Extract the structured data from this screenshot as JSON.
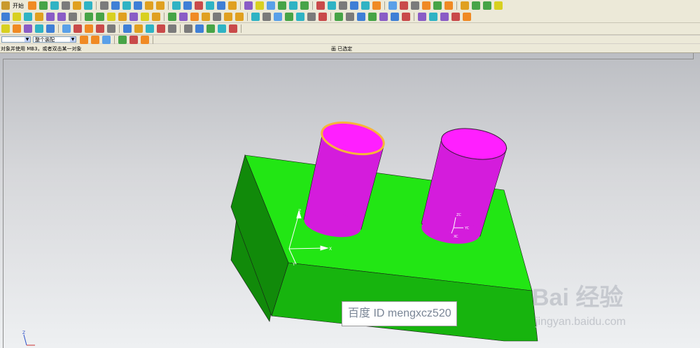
{
  "menu": {
    "start_label": "开始"
  },
  "toolbar": {
    "row1_icons": [
      "new-icon",
      "open-icon",
      "save-icon",
      "cut-icon",
      "copy-icon",
      "paste-icon",
      "undo-icon",
      "redo-icon",
      "select-icon",
      "zoom-fit-icon",
      "rotate-icon",
      "pan-icon",
      "cube-icon",
      "sphere-icon",
      "sketch-icon",
      "layer-icon",
      "measure-icon",
      "point-icon",
      "plane-icon",
      "edge-icon",
      "face-icon",
      "body-icon",
      "snap-icon",
      "analysis-icon",
      "render-icon",
      "shade-icon",
      "wire-icon",
      "view-icon",
      "camera-icon",
      "lights-icon",
      "grid-icon",
      "color-icon",
      "filter-icon",
      "info-icon",
      "group-icon",
      "assembly-icon",
      "drafting-icon",
      "motion-icon",
      "cam-icon",
      "help-icon"
    ],
    "row2_icons": [
      "block-icon",
      "cylinder-icon",
      "cone-icon",
      "extrude-icon",
      "revolve-icon",
      "hole-icon",
      "boss-icon",
      "pocket-icon",
      "pad-icon",
      "slot-icon",
      "groove-icon",
      "thread-icon",
      "blend-icon",
      "chamfer-icon",
      "shell-icon",
      "trim-icon",
      "split-icon",
      "unite-icon",
      "subtract-icon",
      "intersect-icon",
      "mirror-icon",
      "pattern-icon",
      "offset-icon",
      "scale-icon",
      "draft-icon",
      "sweep-icon",
      "loft-icon",
      "surface-icon",
      "sew-icon",
      "patch-icon",
      "curve-icon",
      "line-icon",
      "arc-icon",
      "spline-icon",
      "fillet-icon",
      "move-icon",
      "copy-feature-icon",
      "suppress-icon",
      "edit-icon",
      "replay-icon"
    ],
    "row3_icons": [
      "sketch-line-icon",
      "sketch-arc-icon",
      "sketch-fillet-icon",
      "sketch-trim-icon",
      "sketch-extend-icon",
      "dimension-icon",
      "constraint-icon",
      "surface-mesh-icon",
      "through-curves-icon",
      "swept-icon",
      "ruled-icon",
      "bounded-plane-icon",
      "offset-surface-icon",
      "extension-icon",
      "trim-sheet-icon",
      "thicken-icon",
      "section-icon",
      "studio-icon",
      "flange-icon",
      "sheet-metal-icon"
    ],
    "row4_icons": [
      "select-filter-icon",
      "point-snap-icon",
      "endpoint-icon",
      "midpoint-icon",
      "center-icon",
      "quadrant-icon"
    ]
  },
  "filter_bar": {
    "type_filter_value": "",
    "assembly_filter_value": "整个装配"
  },
  "status_bar": {
    "prompt": "对象并使用 MB3，或者双击某一对象",
    "selection": "画 已选定"
  },
  "overlay": {
    "watermark_text": "百度 ID mengxcz520",
    "baidu_logo": "Bai 经验",
    "baidu_url": "jingyan.baidu.com"
  },
  "axes": {
    "part_x": "X",
    "part_y": "Y",
    "part_z": "Z",
    "wcs_xc": "XC",
    "wcs_yc": "YC",
    "wcs_zc": "ZC"
  },
  "colors": {
    "block_top": "#22e614",
    "block_front": "#17b40e",
    "block_side": "#118a0a",
    "cylinder_body": "#d41cdc",
    "cylinder_top": "#ff1fff",
    "highlight_edge": "#f7b43a",
    "background_top": "#bcbec3",
    "background_bottom": "#eef0f2"
  }
}
